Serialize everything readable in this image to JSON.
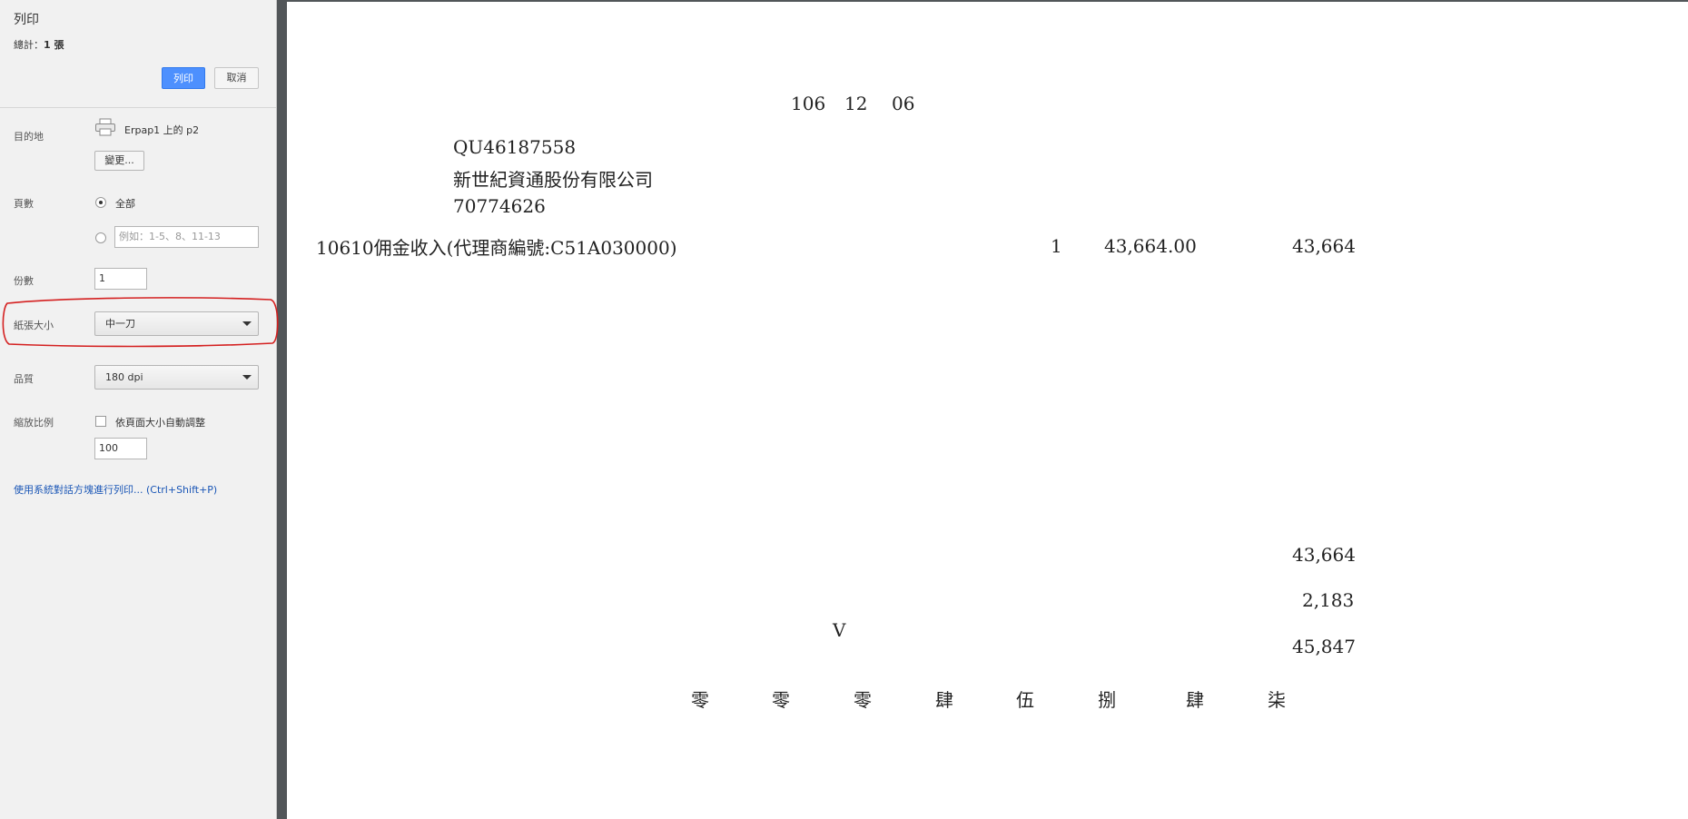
{
  "sidebar": {
    "title": "列印",
    "total_label": "總計：",
    "total_value": "1 張",
    "print_button": "列印",
    "cancel_button": "取消",
    "destination": {
      "label": "目的地",
      "printer": "Erpap1 上的 p2",
      "change_button": "變更..."
    },
    "pages": {
      "label": "頁數",
      "all_option": "全部",
      "custom_placeholder": "例如：1-5、8、11-13"
    },
    "copies": {
      "label": "份數",
      "value": "1"
    },
    "paper_size": {
      "label": "紙張大小",
      "value": "中一刀"
    },
    "quality": {
      "label": "品質",
      "value": "180 dpi"
    },
    "scale": {
      "label": "縮放比例",
      "fit_option": "依頁面大小自動調整",
      "value": "100"
    },
    "system_dialog_link": "使用系統對話方塊進行列印... (Ctrl+Shift+P)"
  },
  "document": {
    "date_year": "106",
    "date_month": "12",
    "date_day": "06",
    "code": "QU46187558",
    "company": "新世紀資通股份有限公司",
    "tax_id": "70774626",
    "item_description": "10610佣金收入(代理商編號:C51A030000)",
    "item_quantity": "1",
    "item_unit_price": "43,664.00",
    "item_amount": "43,664",
    "subtotal": "43,664",
    "tax": "2,183",
    "total": "45,847",
    "tax_mark": "V",
    "amount_in_words": [
      "零",
      "零",
      "零",
      "肆",
      "伍",
      "捌",
      "肆",
      "柒"
    ]
  },
  "colors": {
    "accent": "#4d90fe",
    "link": "#1a56b6",
    "annotation": "#d42020"
  }
}
